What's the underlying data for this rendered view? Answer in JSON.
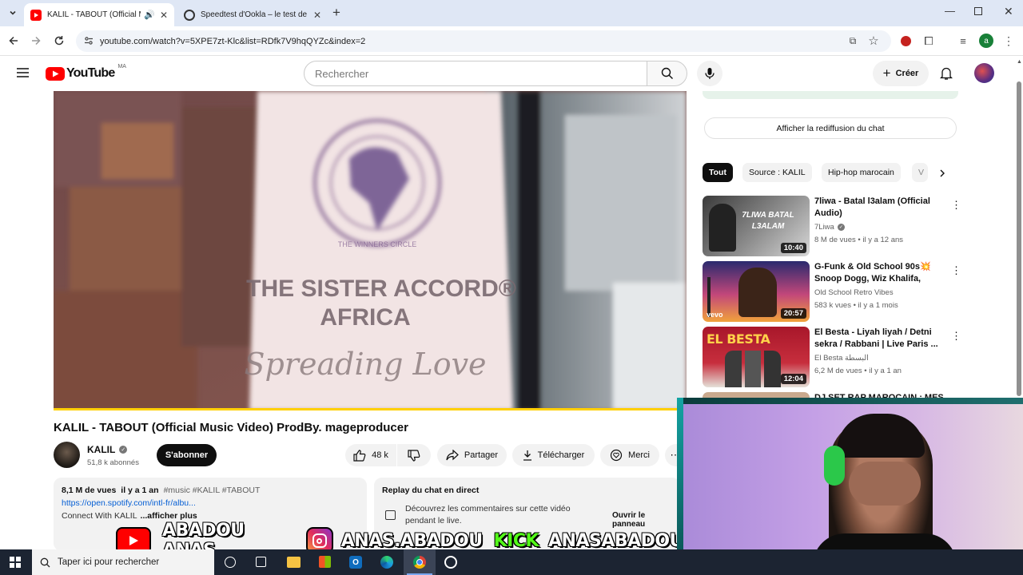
{
  "browser": {
    "tabs": [
      {
        "title": "KALIL - TABOUT (Official M",
        "active": true
      },
      {
        "title": "Speedtest d'Ookla – le test de",
        "active": false
      }
    ],
    "url": "youtube.com/watch?v=5XPE7zt-Klc&list=RDfk7V9hqQYZc&index=2",
    "profile_initial": "a"
  },
  "youtube": {
    "logo_text": "YouTube",
    "region": "MA",
    "search_placeholder": "Rechercher",
    "create_label": "Créer"
  },
  "video": {
    "title": "KALIL - TABOUT (Official Music Video) ProdBy. mageproducer",
    "frame_text": {
      "sign_line1": "THE SISTER ACCORD®",
      "sign_line2": "AFRICA",
      "sign_script": "Spreading Love",
      "logo_ring": "THE WINNERS CIRCLE"
    },
    "progress_fraction": 1.0
  },
  "channel": {
    "name": "KALIL",
    "subscribers": "51,8 k abonnés",
    "subscribe_label": "S'abonner"
  },
  "actions": {
    "likes": "48 k",
    "share": "Partager",
    "download": "Télécharger",
    "thanks": "Merci"
  },
  "description": {
    "views": "8,1 M de vues",
    "age": "il y a 1 an",
    "tags": "#music #KALIL #TABOUT",
    "link": "https://open.spotify.com/intl-fr/albu...",
    "text": "Connect With KALIL",
    "more": "...afficher plus"
  },
  "chat_replay": {
    "title": "Replay du chat en direct",
    "text_line1": "Découvrez les commentaires sur cette vidéo",
    "text_line2": "pendant le live.",
    "button": "Ouvrir le panneau"
  },
  "sidebar": {
    "chat_button": "Afficher la rediffusion du chat",
    "chips": [
      "Tout",
      "Source : KALIL",
      "Hip-hop marocain",
      "V"
    ],
    "recommendations": [
      {
        "title": "7liwa - Batal l3alam (Official Audio)",
        "channel": "7Liwa",
        "verified": true,
        "meta": "8 M de vues • il y a 12 ans",
        "duration": "10:40",
        "thumb_text": "7LIWA BATAL L3ALAM"
      },
      {
        "title": "G-Funk & Old School 90s💥 Snoop Dogg, Wiz Khalifa, Tyga...",
        "channel": "Old School Retro Vibes",
        "verified": false,
        "meta": "583 k vues • il y a 1 mois",
        "duration": "20:57",
        "thumb_text": "vevo"
      },
      {
        "title": "El Besta - Liyah liyah / Detni sekra / Rabbani | Live Paris ...",
        "channel": "El Besta البسطة",
        "verified": false,
        "meta": "6,2 M de vues • il y a 1 an",
        "duration": "12:04",
        "thumb_text": "EL BESTA"
      },
      {
        "title": "DJ SET RAP MAROCAIN : MES",
        "channel": "",
        "verified": false,
        "meta": "",
        "duration": "",
        "thumb_text": ""
      }
    ]
  },
  "overlay": {
    "youtube_handle": "ABADOU ANAS",
    "instagram_handle": "ANAS.ABADOU",
    "kick_label": "KICK",
    "kick_handle": "ANASABADOU"
  },
  "taskbar": {
    "search_placeholder": "Taper ici pour rechercher"
  },
  "colors": {
    "youtube_red": "#ff0000",
    "kick_green": "#53fc18",
    "taskbar": "#1c2432",
    "chip_active": "#0f0f0f"
  }
}
